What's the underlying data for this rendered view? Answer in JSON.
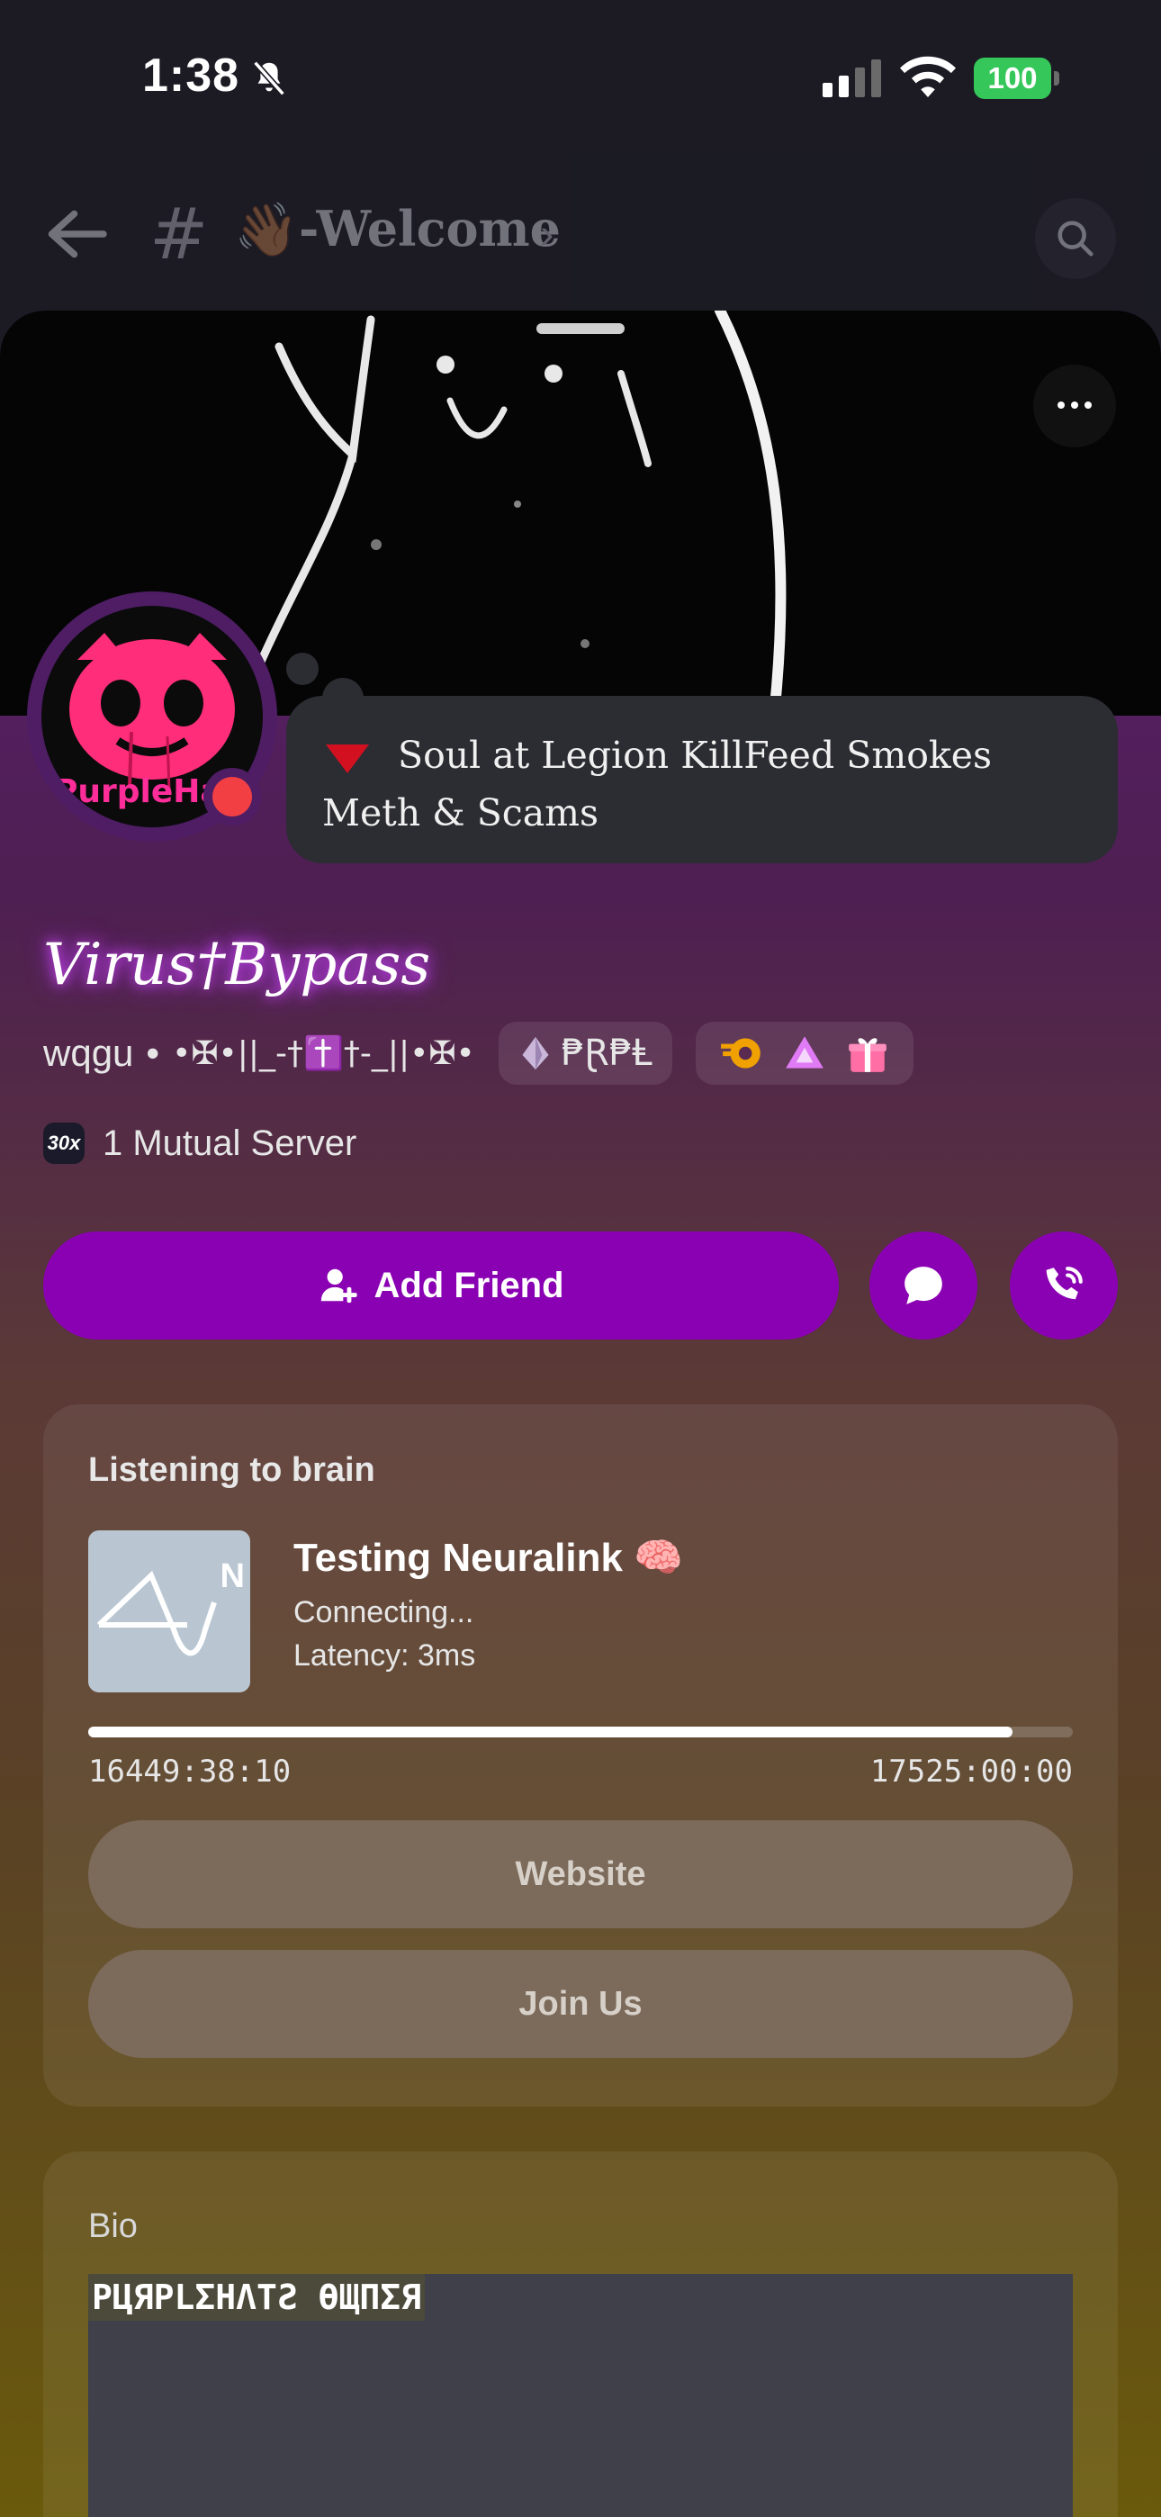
{
  "status_bar": {
    "time": "1:38",
    "battery": "100"
  },
  "channel_header": {
    "hash": "#",
    "wave_emoji": "👋🏾",
    "title": "-Welcome",
    "chevron": "›"
  },
  "profile": {
    "custom_status": "Soul at Legion KillFeed Smokes Meth & Scams",
    "display_name": "Virus†Bypass",
    "username": "wqgu",
    "separator": "•",
    "pronouns": "•✠•||_-†✝️†-_||•✠•",
    "guild_tag": "₱Ɽ₱Ⱡ",
    "status": "dnd",
    "avatar_text": "PurpleHat"
  },
  "mutual": {
    "server_icon_text": "30x",
    "label": "1 Mutual Server"
  },
  "actions": {
    "add_friend": "Add Friend"
  },
  "activity": {
    "header": "Listening to brain",
    "title": "Testing Neuralink 🧠",
    "line1": "Connecting...",
    "line2": "Latency: 3ms",
    "image_letter": "N",
    "elapsed": "16449:38:10",
    "total": "17525:00:00",
    "progress": 0.939,
    "buttons": [
      "Website",
      "Join Us"
    ]
  },
  "bio": {
    "header": "Bio",
    "text": "PЦЯPLΣHΛTƧ ӨЩПΣЯ"
  },
  "colors": {
    "accent": "#8a00b3",
    "dnd": "#f23f43",
    "online_battery": "#35c759"
  }
}
